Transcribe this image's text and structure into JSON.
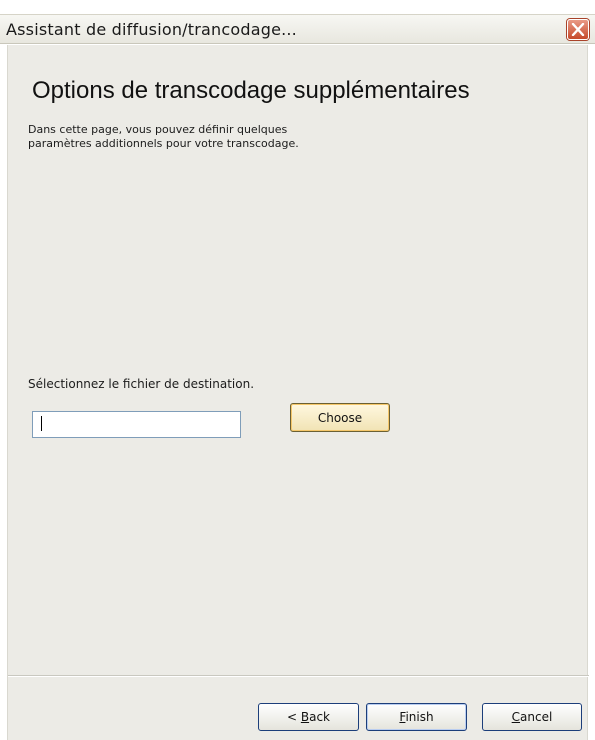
{
  "window": {
    "title": "Assistant de diffusion/trancodage..."
  },
  "page": {
    "heading": "Options de transcodage supplémentaires",
    "description_line1": "Dans cette page, vous pouvez définir quelques",
    "description_line2": "paramètres additionnels pour votre transcodage."
  },
  "destination": {
    "label": "Sélectionnez le fichier de destination.",
    "value": "",
    "choose_label": "Choose"
  },
  "footer": {
    "back": {
      "prefix": "< ",
      "mnemonic": "B",
      "rest": "ack"
    },
    "finish": {
      "mnemonic": "F",
      "rest": "inish"
    },
    "cancel": {
      "mnemonic": "C",
      "rest": "ancel"
    }
  },
  "icons": {
    "close": "close-icon"
  },
  "colors": {
    "close_button": "#c64a2b",
    "dialog_background": "#ecebe6",
    "choose_button_highlight": "#f5c76a"
  }
}
